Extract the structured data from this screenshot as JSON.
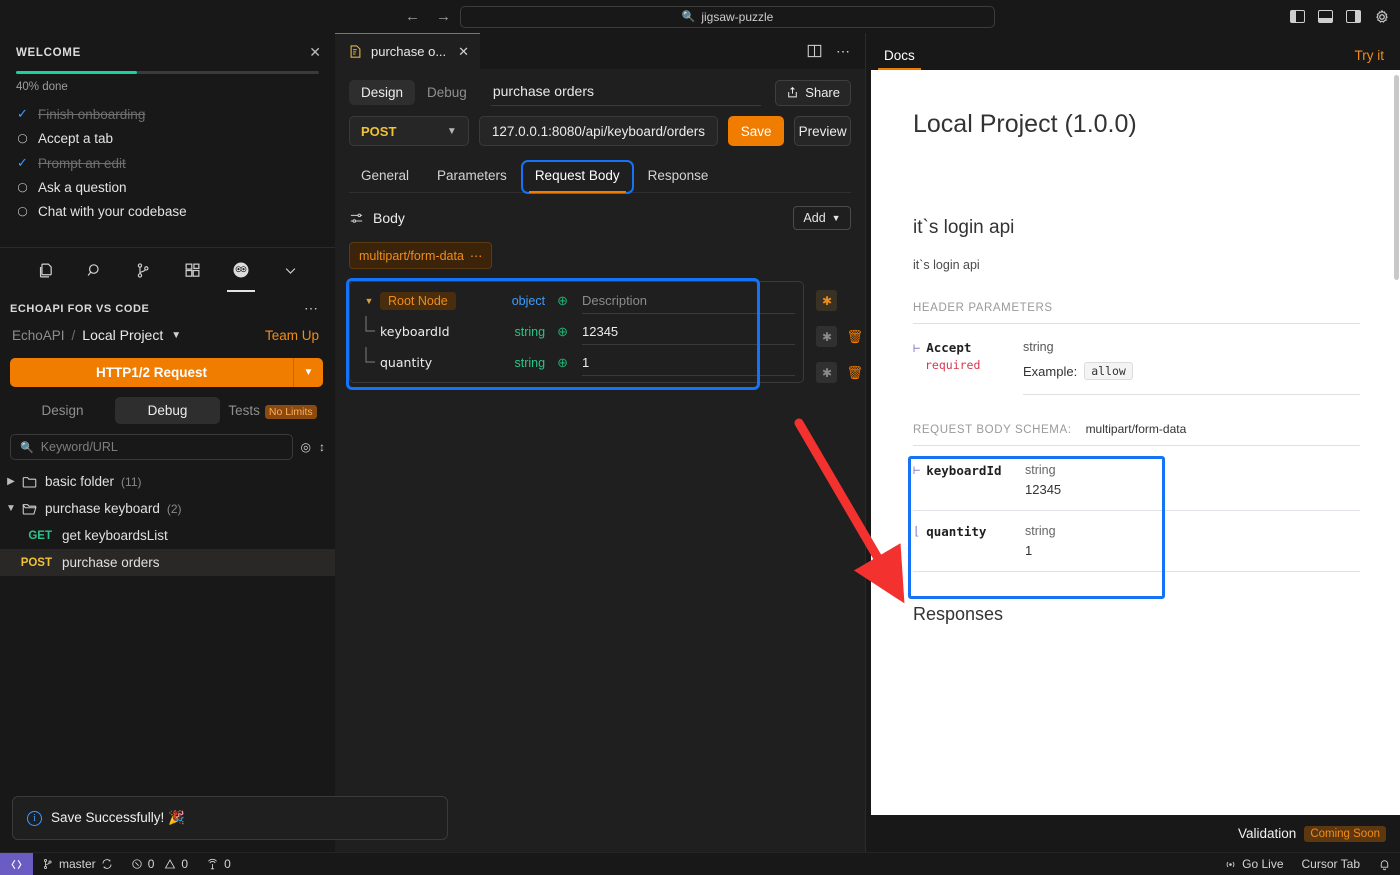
{
  "titlebar": {
    "back_icon": "arrow-left-icon",
    "forward_icon": "arrow-right-icon",
    "search_value": "jigsaw-puzzle",
    "search_icon": "search-icon",
    "toggle_primary_sidebar": "layout-left-icon",
    "toggle_panel": "layout-bottom-icon",
    "toggle_secondary_sidebar": "layout-right-icon",
    "settings": "gear-icon"
  },
  "welcome": {
    "title": "WELCOME",
    "close_icon": "close-icon",
    "progress_percent": 40,
    "progress_label": "40% done",
    "items": [
      {
        "label": "Finish onboarding",
        "done": true
      },
      {
        "label": "Accept a tab",
        "done": false
      },
      {
        "label": "Prompt an edit",
        "done": true
      },
      {
        "label": "Ask a question",
        "done": false
      },
      {
        "label": "Chat with your codebase",
        "done": false
      }
    ]
  },
  "activity_icons": [
    {
      "name": "explorer-icon"
    },
    {
      "name": "search-icon"
    },
    {
      "name": "source-control-icon"
    },
    {
      "name": "extensions-icon"
    },
    {
      "name": "echoapi-icon",
      "active": true
    },
    {
      "name": "chevron-down-icon"
    }
  ],
  "extension": {
    "header": "ECHOAPI FOR VS CODE",
    "more_icon": "more-horizontal-icon",
    "breadcrumb_root": "EchoAPI",
    "breadcrumb_sep": "/",
    "breadcrumb_project": "Local Project",
    "project_caret": "chevron-down-icon",
    "team_up": "Team Up",
    "request_button": "HTTP1/2 Request",
    "request_caret": "chevron-down-icon",
    "tabs": [
      {
        "label": "Design",
        "active": false
      },
      {
        "label": "Debug",
        "active": true
      },
      {
        "label": "Tests",
        "active": false,
        "badge": "No Limits"
      }
    ],
    "search_placeholder": "Keyword/URL",
    "search_icon": "search-icon",
    "locate_icon": "target-icon",
    "sort_icon": "sort-icon",
    "tree": [
      {
        "type": "folder",
        "caret": "chevron-right-icon",
        "label": "basic folder",
        "count": "(11)",
        "expanded": false,
        "selected": false
      },
      {
        "type": "folder",
        "caret": "chevron-down-icon",
        "label": "purchase keyboard",
        "count": "(2)",
        "expanded": true,
        "selected": false
      },
      {
        "type": "request",
        "method": "GET",
        "label": "get keyboardsList",
        "selected": false
      },
      {
        "type": "request",
        "method": "POST",
        "label": "purchase orders",
        "selected": true
      }
    ]
  },
  "toast": {
    "icon": "info-icon",
    "message": "Save Successfully! 🎉"
  },
  "editor": {
    "tab": {
      "icon": "api-doc-icon",
      "label": "purchase o...",
      "close_icon": "close-icon"
    },
    "tabstrip_split_icon": "split-editor-icon",
    "tabstrip_more_icon": "more-horizontal-icon",
    "mode_tabs": [
      {
        "label": "Design",
        "active": true
      },
      {
        "label": "Debug",
        "active": false
      }
    ],
    "api_name": "purchase orders",
    "share_label": "Share",
    "share_icon": "share-icon",
    "method": "POST",
    "method_caret": "chevron-down-icon",
    "url": "127.0.0.1:8080/api/keyboard/orders",
    "save_label": "Save",
    "preview_label": "Preview",
    "subtabs": [
      {
        "label": "General",
        "selected": false,
        "highlighted": false
      },
      {
        "label": "Parameters",
        "selected": false,
        "highlighted": false
      },
      {
        "label": "Request Body",
        "selected": true,
        "highlighted": true
      },
      {
        "label": "Response",
        "selected": false,
        "highlighted": false
      }
    ],
    "body_icon": "sliders-icon",
    "body_label": "Body",
    "add_label": "Add",
    "add_caret": "chevron-down-icon",
    "content_type": "multipart/form-data",
    "content_type_more": "···",
    "schema_rows": [
      {
        "kind": "root",
        "caret": "chevron-down-icon",
        "name": "Root Node",
        "type": "object",
        "plus_icon": "plus-circle-icon",
        "value": "Description",
        "value_is_placeholder": true,
        "star_on": true,
        "has_delete": false
      },
      {
        "kind": "field",
        "name": "keyboardId",
        "type": "string",
        "plus_icon": "plus-circle-icon",
        "value": "12345",
        "value_is_placeholder": false,
        "star_on": false,
        "has_delete": true,
        "delete_icon": "trash-icon"
      },
      {
        "kind": "field",
        "name": "quantity",
        "type": "string",
        "plus_icon": "plus-circle-icon",
        "value": "1",
        "value_is_placeholder": false,
        "star_on": false,
        "has_delete": true,
        "delete_icon": "trash-icon"
      }
    ]
  },
  "docs": {
    "tab_label": "Docs",
    "try_it_label": "Try it",
    "project_title": "Local Project (1.0.0)",
    "api_title": "it`s login api",
    "api_desc": "it`s login api",
    "header_params_label": "HEADER PARAMETERS",
    "header_params": [
      {
        "name": "Accept",
        "required_label": "required",
        "type": "string",
        "example_label": "Example:",
        "example_value": "allow"
      }
    ],
    "request_body_schema_label": "REQUEST BODY SCHEMA:",
    "request_body_schema_value": "multipart/form-data",
    "schema_fields": [
      {
        "name": "keyboardId",
        "type": "string",
        "value": "12345"
      },
      {
        "name": "quantity",
        "type": "string",
        "value": "1"
      }
    ],
    "responses_label": "Responses"
  },
  "validation": {
    "label": "Validation",
    "badge": "Coming Soon"
  },
  "statusbar": {
    "remote_icon": "remote-window-icon",
    "branch_icon": "git-branch-icon",
    "branch": "master",
    "sync_icon": "sync-icon",
    "errors_icon": "error-icon",
    "errors": "0",
    "warnings_icon": "warning-icon",
    "warnings": "0",
    "ports_icon": "ports-icon",
    "ports": "0",
    "go_live_icon": "broadcast-icon",
    "go_live": "Go Live",
    "cursor_tab": "Cursor Tab",
    "bell_icon": "bell-icon"
  },
  "colors": {
    "accent_orange": "#f07c00",
    "highlight_blue": "#1574f5",
    "arrow_red": "#f3312f",
    "progress_green": "#16d3a0",
    "get_green": "#2bc48a",
    "post_yellow": "#f1c232"
  }
}
